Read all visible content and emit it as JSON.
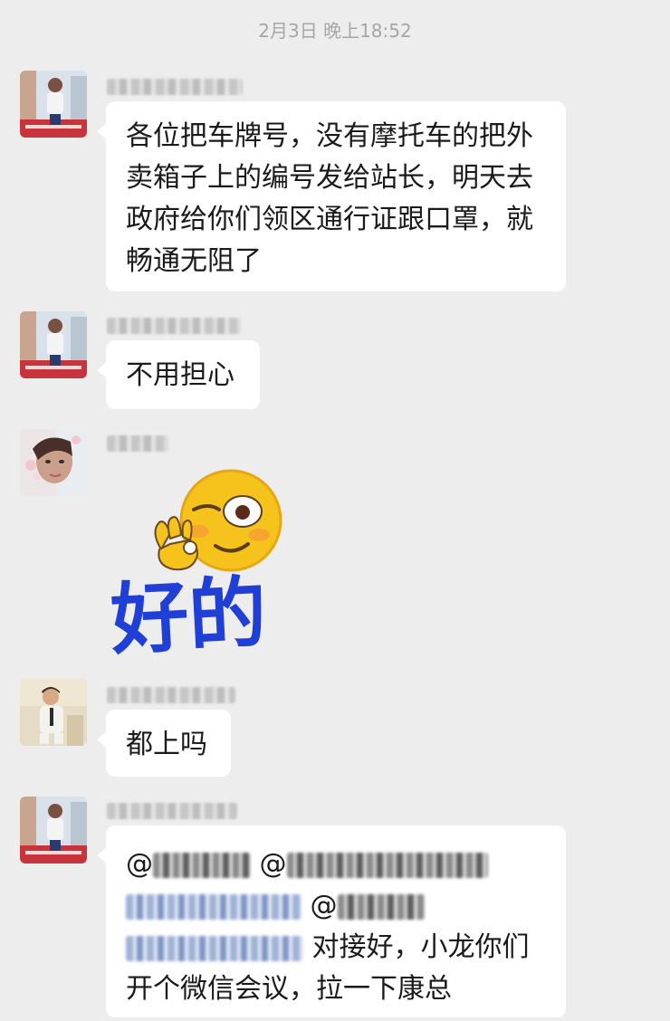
{
  "timestamp": "2月3日 晚上18:52",
  "messages": [
    {
      "lines": [
        "各位把车牌号，没有摩托车的把外",
        "卖箱子上的编号发给站长，明天去",
        "政府给你们领区通行证跟口罩，就",
        "畅通无阻了"
      ]
    },
    {
      "lines": [
        "不用担心"
      ]
    },
    {
      "sticker": {
        "text": "好的",
        "emoji": "wink-ok-emoji"
      }
    },
    {
      "lines": [
        "都上吗"
      ]
    },
    {
      "mention_prefix": "@",
      "line4_text": "对接好，小龙你们",
      "line5_text": "开个微信会议，拉一下康总"
    }
  ],
  "colors": {
    "background": "#ededed",
    "bubble": "#ffffff",
    "timestamp": "#a6a6a6",
    "sticker_text": "#1f3fd6",
    "emoji_face": "#f6c21c"
  }
}
